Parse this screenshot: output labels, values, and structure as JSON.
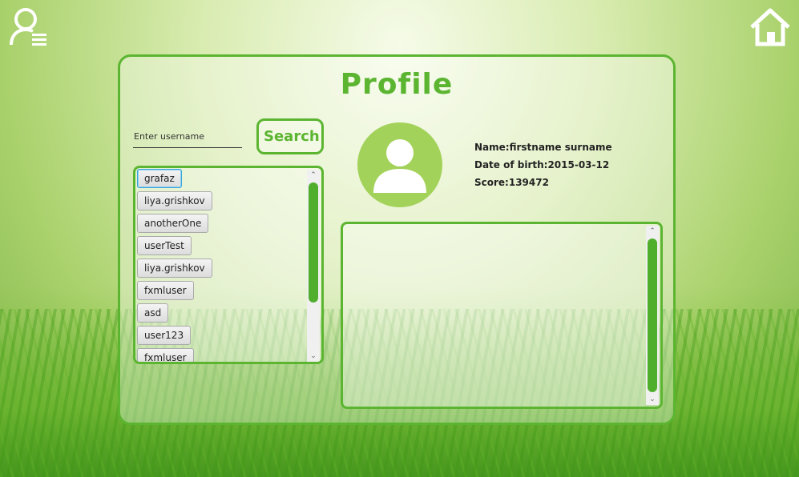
{
  "header": {
    "user_menu_icon": "user-list-icon",
    "home_icon": "home-icon"
  },
  "profile": {
    "title": "Profile",
    "search": {
      "placeholder": "Enter username",
      "button_label": "Search"
    },
    "users": [
      "grafaz",
      "liya.grishkov",
      "anotherOne",
      "userTest",
      "liya.grishkov",
      "fxmluser",
      "asd",
      "user123",
      "fxmluser"
    ],
    "selected_user": "grafaz",
    "info": {
      "name": "Name:firstname surname",
      "dob": "Date of birth:2015-03-12",
      "score": "Score:139472"
    },
    "avatar_icon": "user-avatar-icon"
  },
  "colors": {
    "accent": "#5cb531",
    "avatar_bg": "#a3d25a"
  }
}
